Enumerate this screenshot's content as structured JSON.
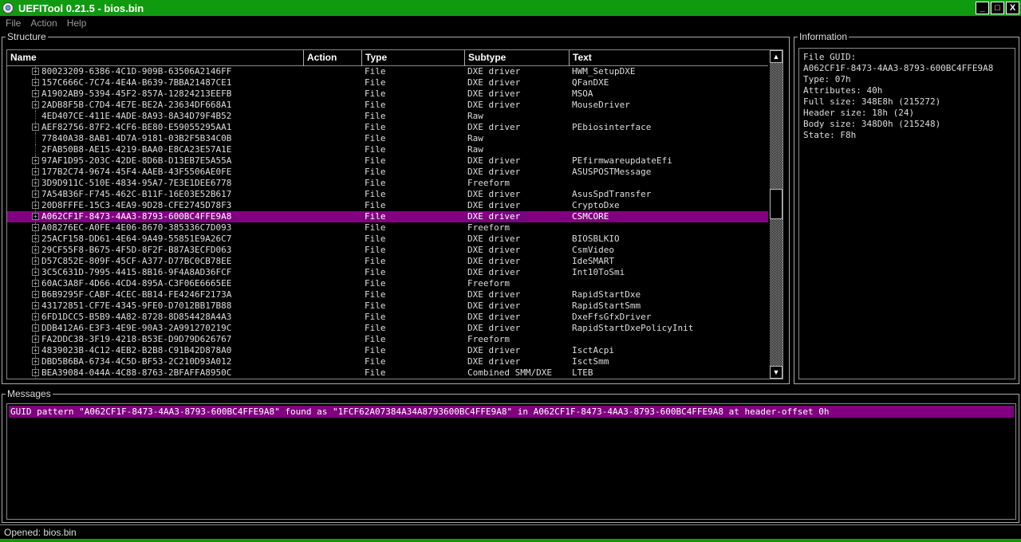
{
  "window": {
    "title": "UEFITool 0.21.5 - bios.bin",
    "minimize": "_",
    "maximize": "□",
    "close": "X"
  },
  "menu": [
    "File",
    "Action",
    "Help"
  ],
  "structure": {
    "title": "Structure",
    "columns": {
      "name": "Name",
      "action": "Action",
      "type": "Type",
      "subtype": "Subtype",
      "text": "Text"
    },
    "rows": [
      {
        "name": "80023209-6386-4C1D-909B-63506A2146FF",
        "type": "File",
        "subtype": "DXE driver",
        "text": "HWM_SetupDXE",
        "expand": true
      },
      {
        "name": "157C666C-7C74-4E4A-B639-7BBA21487CE1",
        "type": "File",
        "subtype": "DXE driver",
        "text": "QFanDXE",
        "expand": true
      },
      {
        "name": "A1902AB9-5394-45F2-857A-12824213EEFB",
        "type": "File",
        "subtype": "DXE driver",
        "text": "MSOA",
        "expand": true
      },
      {
        "name": "2ADB8F5B-C7D4-4E7E-BE2A-23634DF668A1",
        "type": "File",
        "subtype": "DXE driver",
        "text": "MouseDriver",
        "expand": true
      },
      {
        "name": "4ED407CE-411E-4ADE-8A93-8A34D79F4B52",
        "type": "File",
        "subtype": "Raw",
        "text": "",
        "expand": false
      },
      {
        "name": "AEF82756-87F2-4CF6-BE80-E59055295AA1",
        "type": "File",
        "subtype": "DXE driver",
        "text": "PEbiosinterface",
        "expand": true
      },
      {
        "name": "77840A38-8AB1-4D7A-9181-03B2F5B34C0B",
        "type": "File",
        "subtype": "Raw",
        "text": "",
        "expand": false
      },
      {
        "name": "2FAB50B8-AE15-4219-BAA0-E8CA23E57A1E",
        "type": "File",
        "subtype": "Raw",
        "text": "",
        "expand": false
      },
      {
        "name": "97AF1D95-203C-42DE-8D6B-D13EB7E5A55A",
        "type": "File",
        "subtype": "DXE driver",
        "text": "PEfirmwareupdateEfi",
        "expand": true
      },
      {
        "name": "177B2C74-9674-45F4-AAEB-43F5506AE0FE",
        "type": "File",
        "subtype": "DXE driver",
        "text": "ASUSPOSTMessage",
        "expand": true
      },
      {
        "name": "3D9D911C-510E-4834-95A7-7E3E1DEE6778",
        "type": "File",
        "subtype": "Freeform",
        "text": "",
        "expand": true
      },
      {
        "name": "7A54B36F-F745-462C-B11F-16E03E52B617",
        "type": "File",
        "subtype": "DXE driver",
        "text": "AsusSpdTransfer",
        "expand": true
      },
      {
        "name": "20D8FFFE-15C3-4EA9-9D28-CFE2745D78F3",
        "type": "File",
        "subtype": "DXE driver",
        "text": "CryptoDxe",
        "expand": true
      },
      {
        "name": "A062CF1F-8473-4AA3-8793-600BC4FFE9A8",
        "type": "File",
        "subtype": "DXE driver",
        "text": "CSMCORE",
        "expand": true,
        "selected": true
      },
      {
        "name": "A08276EC-A0FE-4E06-8670-385336C7D093",
        "type": "File",
        "subtype": "Freeform",
        "text": "",
        "expand": true
      },
      {
        "name": "25ACF158-DD61-4E64-9A49-55851E9A26C7",
        "type": "File",
        "subtype": "DXE driver",
        "text": "BIOSBLKIO",
        "expand": true
      },
      {
        "name": "29CF55F8-B675-4F5D-8F2F-B87A3ECFD063",
        "type": "File",
        "subtype": "DXE driver",
        "text": "CsmVideo",
        "expand": true
      },
      {
        "name": "D57C852E-809F-45CF-A377-D77BC0CB78EE",
        "type": "File",
        "subtype": "DXE driver",
        "text": "IdeSMART",
        "expand": true
      },
      {
        "name": "3C5C631D-7995-4415-8B16-9F4A8AD36FCF",
        "type": "File",
        "subtype": "DXE driver",
        "text": "Int10ToSmi",
        "expand": true
      },
      {
        "name": "60AC3A8F-4D66-4CD4-895A-C3F06E6665EE",
        "type": "File",
        "subtype": "Freeform",
        "text": "",
        "expand": true
      },
      {
        "name": "B6B9295F-CABF-4CEC-BB14-FE4246F2173A",
        "type": "File",
        "subtype": "DXE driver",
        "text": "RapidStartDxe",
        "expand": true
      },
      {
        "name": "43172851-CF7E-4345-9FE0-D7012BB17B88",
        "type": "File",
        "subtype": "DXE driver",
        "text": "RapidStartSmm",
        "expand": true
      },
      {
        "name": "6FD1DCC5-B5B9-4A82-8728-8D854428A4A3",
        "type": "File",
        "subtype": "DXE driver",
        "text": "DxeFfsGfxDriver",
        "expand": true
      },
      {
        "name": "DDB412A6-E3F3-4E9E-90A3-2A991270219C",
        "type": "File",
        "subtype": "DXE driver",
        "text": "RapidStartDxePolicyInit",
        "expand": true
      },
      {
        "name": "FA2DDC38-3F19-4218-B53E-D9D79D626767",
        "type": "File",
        "subtype": "Freeform",
        "text": "",
        "expand": true
      },
      {
        "name": "4839023B-4C12-4EB2-B2B8-C91B42D878A0",
        "type": "File",
        "subtype": "DXE driver",
        "text": "IsctAcpi",
        "expand": true
      },
      {
        "name": "DBD5B6BA-6734-4C5D-BF53-2C210D93A012",
        "type": "File",
        "subtype": "DXE driver",
        "text": "IsctSmm",
        "expand": true
      },
      {
        "name": "BEA39084-044A-4C88-8763-2BFAFFA8950C",
        "type": "File",
        "subtype": "Combined SMM/DXE",
        "text": "LTEB",
        "expand": true
      }
    ]
  },
  "information": {
    "title": "Information",
    "lines": [
      "File GUID:",
      "A062CF1F-8473-4AA3-8793-600BC4FFE9A8",
      "Type: 07h",
      "Attributes: 40h",
      "Full size: 348E8h (215272)",
      "Header size: 18h (24)",
      "Body size: 348D0h (215248)",
      "State: F8h"
    ]
  },
  "messages": {
    "title": "Messages",
    "lines": [
      "GUID pattern \"A062CF1F-8473-4AA3-8793-600BC4FFE9A8\" found as \"1FCF62A07384A34A8793600BC4FFE9A8\" in A062CF1F-8473-4AA3-8793-600BC4FFE9A8 at header-offset 0h"
    ]
  },
  "status": "Opened: bios.bin",
  "colors": {
    "titlebar": "#109a10",
    "selection": "#800080"
  },
  "icons": {
    "app": "uefitool-icon",
    "expand": "plus-expander-icon",
    "scroll_up": "arrow-up-icon",
    "scroll_down": "arrow-down-icon"
  }
}
